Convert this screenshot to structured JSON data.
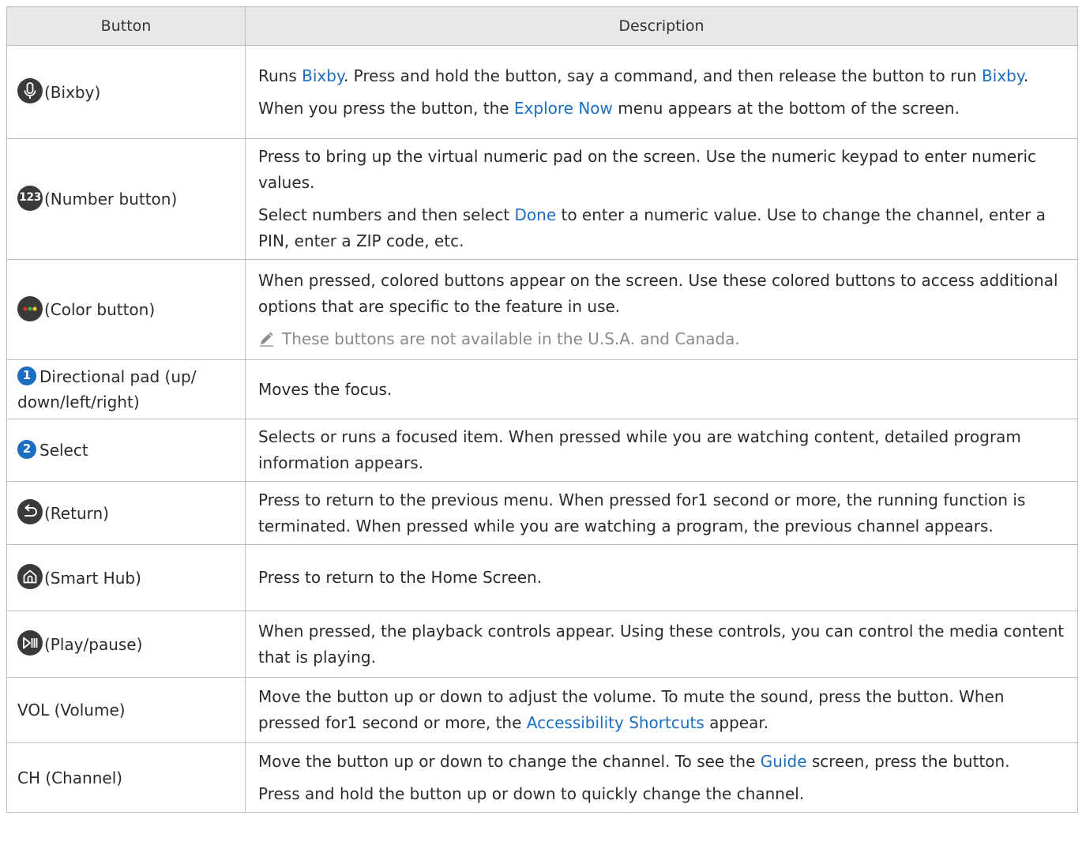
{
  "header": {
    "button": "Button",
    "description": "Description"
  },
  "rows": [
    {
      "icon": "microphone-icon",
      "label": "(Bixby)",
      "desc": [
        {
          "t1": "Runs ",
          "h1": "Bixby",
          "t2": ". Press and hold the button, say a command, and then release the button to run ",
          "h2": "Bixby",
          "t3": "."
        },
        {
          "t1": "When you press the button, the ",
          "h1": "Explore Now",
          "t2": " menu appears at the bottom of the screen."
        }
      ]
    },
    {
      "icon_text": "123",
      "label": "(Number button)",
      "desc": [
        {
          "t1": "Press to bring up the virtual numeric pad on the screen. Use the numeric keypad to enter numeric values."
        },
        {
          "t1": "Select numbers and then select ",
          "h1": "Done",
          "t2": " to enter a numeric value. Use to change the channel, enter a PIN, enter a ZIP code, etc."
        }
      ]
    },
    {
      "icon": "color-dots-icon",
      "label": "(Color button)",
      "desc": [
        {
          "t1": "When pressed, colored buttons appear on the screen. Use these colored buttons to access additional options that are specific to the feature in use."
        }
      ],
      "note": "These buttons are not available in the U.S.A. and Canada."
    },
    {
      "badge": "1",
      "label": "Directional pad (up/ down/left/right)",
      "desc": [
        {
          "t1": "Moves the focus."
        }
      ]
    },
    {
      "badge": "2",
      "label": "Select",
      "desc": [
        {
          "t1": "Selects or runs a focused item. When pressed while you are watching content, detailed program information appears."
        }
      ]
    },
    {
      "icon": "return-icon",
      "label": "(Return)",
      "desc": [
        {
          "t1": "Press to return to the previous menu. When pressed for1 second or more, the running function is terminated. When pressed while you are watching a program, the previous channel appears."
        }
      ]
    },
    {
      "icon": "home-icon",
      "label": "(Smart Hub)",
      "desc": [
        {
          "t1": "Press to return to the Home Screen."
        }
      ]
    },
    {
      "icon": "play-pause-icon",
      "label": "(Play/pause)",
      "desc": [
        {
          "t1": "When pressed, the playback controls appear. Using these controls, you can control the media content that is playing."
        }
      ]
    },
    {
      "label": "VOL (Volume)",
      "desc": [
        {
          "t1": "Move the button up or down to adjust the volume. To mute the sound, press the button. When pressed for1 second or more, the ",
          "h1": "Accessibility Shortcuts",
          "t2": " appear."
        }
      ]
    },
    {
      "label": "CH (Channel)",
      "desc": [
        {
          "t1": "Move the button up or down to change the channel. To see the ",
          "h1": "Guide",
          "t2": " screen, press the button."
        },
        {
          "t1": "Press and hold the button up or down to quickly change the channel."
        }
      ]
    }
  ],
  "colors": {
    "highlight": "#1a6dc1",
    "icon_bg": "#3a3a3a",
    "header_bg": "#e7e7e7",
    "dot_red": "#e0312b",
    "dot_green": "#3bb44a",
    "dot_yellow": "#f2c12e"
  }
}
